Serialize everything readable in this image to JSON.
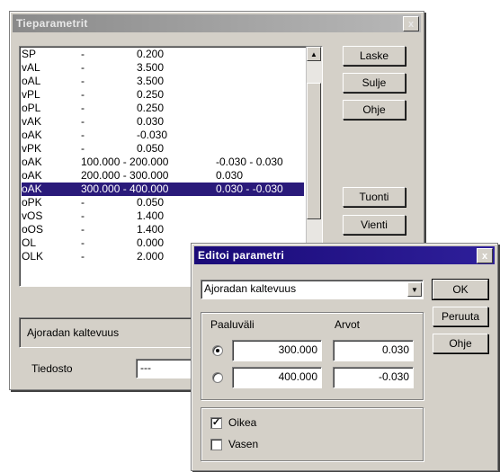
{
  "tieparametrit": {
    "title": "Tieparametrit",
    "close_glyph": "x",
    "rows": [
      {
        "name": "SP",
        "dash": "-",
        "range": "",
        "value": "0.200",
        "selected": false
      },
      {
        "name": "vAL",
        "dash": "-",
        "range": "",
        "value": "3.500",
        "selected": false
      },
      {
        "name": "oAL",
        "dash": "-",
        "range": "",
        "value": "3.500",
        "selected": false
      },
      {
        "name": "vPL",
        "dash": "-",
        "range": "",
        "value": "0.250",
        "selected": false
      },
      {
        "name": "oPL",
        "dash": "-",
        "range": "",
        "value": "0.250",
        "selected": false
      },
      {
        "name": "vAK",
        "dash": "-",
        "range": "",
        "value": "0.030",
        "selected": false
      },
      {
        "name": "oAK",
        "dash": "-",
        "range": "",
        "value": "-0.030",
        "selected": false
      },
      {
        "name": "vPK",
        "dash": "-",
        "range": "",
        "value": "0.050",
        "selected": false
      },
      {
        "name": "oAK",
        "dash": "",
        "range": "100.000 - 200.000",
        "value": "-0.030 - 0.030",
        "selected": false
      },
      {
        "name": "oAK",
        "dash": "",
        "range": "200.000 - 300.000",
        "value": "0.030",
        "selected": false
      },
      {
        "name": "oAK",
        "dash": "",
        "range": "300.000 - 400.000",
        "value": "0.030 - -0.030",
        "selected": true
      },
      {
        "name": "oPK",
        "dash": "-",
        "range": "",
        "value": "0.050",
        "selected": false
      },
      {
        "name": "vOS",
        "dash": "-",
        "range": "",
        "value": "1.400",
        "selected": false
      },
      {
        "name": "oOS",
        "dash": "-",
        "range": "",
        "value": "1.400",
        "selected": false
      },
      {
        "name": "OL",
        "dash": "-",
        "range": "",
        "value": "0.000",
        "selected": false
      },
      {
        "name": "OLK",
        "dash": "-",
        "range": "",
        "value": "2.000",
        "selected": false
      }
    ],
    "buttons": {
      "laske": "Laske",
      "sulje": "Sulje",
      "ohje": "Ohje",
      "tuonti": "Tuonti",
      "vienti": "Vienti"
    },
    "param_label": "Ajoradan kaltevuus",
    "file_label": "Tiedosto",
    "file_value": "---"
  },
  "editoi": {
    "title": "Editoi parametri",
    "close_glyph": "x",
    "dropdown_value": "Ajoradan kaltevuus",
    "buttons": {
      "ok": "OK",
      "peruuta": "Peruuta",
      "ohje": "Ohje"
    },
    "col_paaluvali": "Paaluväli",
    "col_arvot": "Arvot",
    "row1": {
      "paalu": "300.000",
      "arvo": "0.030",
      "selected": true
    },
    "row2": {
      "paalu": "400.000",
      "arvo": "-0.030",
      "selected": false
    },
    "oikea": {
      "label": "Oikea",
      "checked": true,
      "mark": "✓"
    },
    "vasen": {
      "label": "Vasen",
      "checked": false,
      "mark": ""
    }
  },
  "colors": {
    "titlebar_active": "#1a0a78",
    "titlebar_inactive": "#8a8a8a",
    "selection": "#2a1a7a"
  }
}
